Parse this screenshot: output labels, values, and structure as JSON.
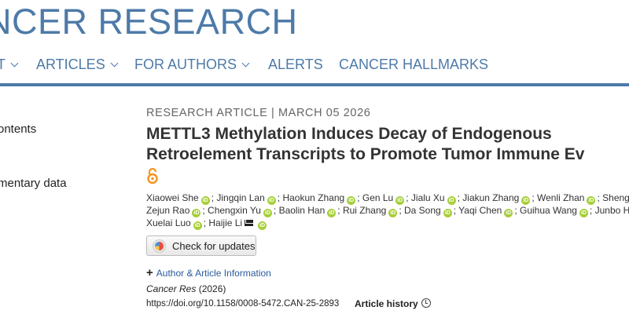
{
  "header": {
    "brand": "NCER RESEARCH",
    "nav": [
      {
        "label": "T",
        "has_chevron": true
      },
      {
        "label": "ARTICLES",
        "has_chevron": true
      },
      {
        "label": "FOR AUTHORS",
        "has_chevron": true
      },
      {
        "label": "ALERTS",
        "has_chevron": false
      },
      {
        "label": "CANCER HALLMARKS",
        "has_chevron": false
      }
    ],
    "accent": "#4d7aa8"
  },
  "sidebar": {
    "items": [
      "ontents",
      "mentary data"
    ]
  },
  "article": {
    "kicker": "RESEARCH ARTICLE |  MARCH 05 2026",
    "title_line1": "METTL3 Methylation Induces Decay of Endogenous",
    "title_line2": "Retroelement Transcripts to Promote Tumor Immune Ev",
    "open_access_icon": "open-access-lock-icon",
    "authors_line1": [
      {
        "name": "Xiaowei She",
        "sep": ";"
      },
      {
        "name": "Jingqin Lan",
        "sep": ";"
      },
      {
        "name": "Haokun Zhang",
        "sep": ";"
      },
      {
        "name": "Gen Lu",
        "sep": ";"
      },
      {
        "name": "Jialu Xu",
        "sep": ";"
      },
      {
        "name": "Jiakun Zhang",
        "sep": ";"
      },
      {
        "name": "Wenli Zhan",
        "sep": ";"
      },
      {
        "name": "Shengjie F",
        "sep": ""
      }
    ],
    "authors_line2": [
      {
        "name": "Zejun Rao",
        "sep": ";"
      },
      {
        "name": "Chengxin Yu",
        "sep": ";"
      },
      {
        "name": "Baolin Han",
        "sep": ";"
      },
      {
        "name": "Rui Zhang",
        "sep": ";"
      },
      {
        "name": "Da Song",
        "sep": ";"
      },
      {
        "name": "Yaqi Chen",
        "sep": ";"
      },
      {
        "name": "Guihua Wang",
        "sep": ";"
      },
      {
        "name": "Junbo Hu",
        "sep": ""
      }
    ],
    "authors_line3": [
      {
        "name": "Xuelai Luo",
        "sep": ";",
        "mail": false
      },
      {
        "name": "Haijie Li",
        "sep": "",
        "mail": true
      }
    ],
    "check_updates": "Check for updates",
    "author_info": "Author & Article Information",
    "journal": "Cancer Res",
    "year": "(2026)",
    "doi": "https://doi.org/10.1158/0008-5472.CAN-25-2893",
    "history": "Article history",
    "orcid_color": "#a6ce39"
  }
}
